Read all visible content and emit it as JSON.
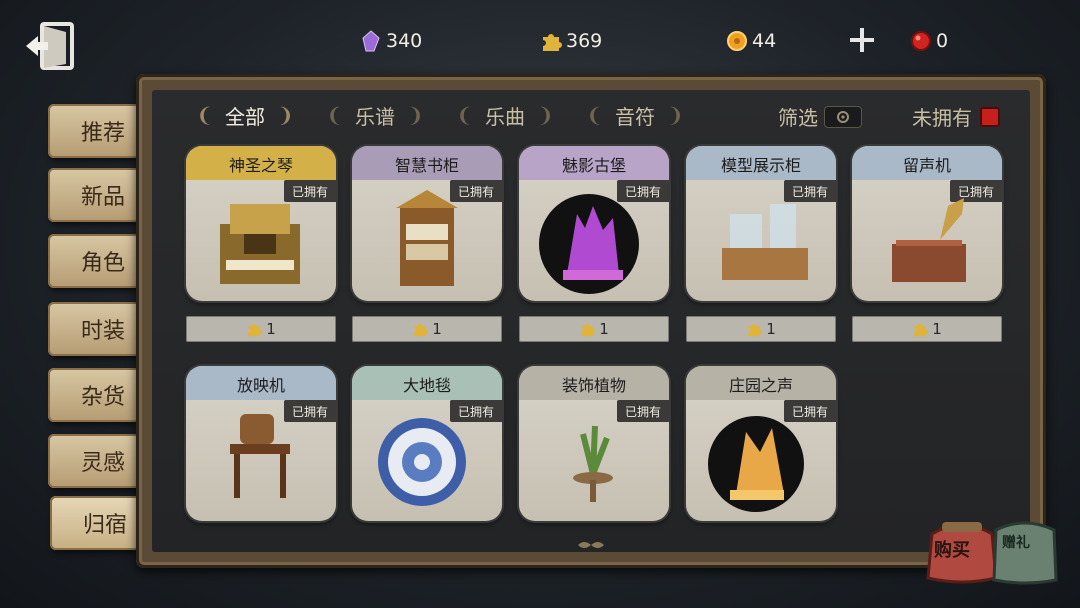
{
  "currencies": [
    {
      "name": "purple-crystal",
      "value": "340",
      "color": "#9b6bd8"
    },
    {
      "name": "puzzle",
      "value": "369",
      "color": "#e0b43a"
    },
    {
      "name": "clue",
      "value": "44",
      "color": "#f0a020"
    },
    {
      "name": "red-gem",
      "value": "0",
      "color": "#d0241f"
    }
  ],
  "side_tabs": [
    "推荐",
    "新品",
    "角色",
    "时装",
    "杂货",
    "灵感",
    "归宿"
  ],
  "active_side_tab": "归宿",
  "filter_tabs": [
    {
      "label": "全部",
      "active": true
    },
    {
      "label": "乐谱",
      "active": false
    },
    {
      "label": "乐曲",
      "active": false
    },
    {
      "label": "音符",
      "active": false
    }
  ],
  "filter_label": "筛选",
  "unowned_label": "未拥有",
  "owned_tag": "已拥有",
  "items": [
    {
      "name": "神圣之琴",
      "price": "1",
      "head_color": "#d4b148",
      "art": "organ"
    },
    {
      "name": "智慧书柜",
      "price": "1",
      "head_color": "#a99cb6",
      "art": "bookcase"
    },
    {
      "name": "魅影古堡",
      "price": "1",
      "head_color": "#b7a4c6",
      "art": "castle"
    },
    {
      "name": "模型展示柜",
      "price": "1",
      "head_color": "#aab9c8",
      "art": "cabinet"
    },
    {
      "name": "留声机",
      "price": "1",
      "head_color": "#aab9c8",
      "art": "gramophone"
    },
    {
      "name": "放映机",
      "price": "",
      "head_color": "#aab9c8",
      "art": "projector"
    },
    {
      "name": "大地毯",
      "price": "",
      "head_color": "#a8c0b6",
      "art": "carpet"
    },
    {
      "name": "装饰植物",
      "price": "",
      "head_color": "#b7b2a6",
      "art": "plant"
    },
    {
      "name": "庄园之声",
      "price": "",
      "head_color": "#b7b2a6",
      "art": "manor"
    }
  ],
  "buy_label": "购买",
  "gift_label": "赠礼",
  "colors": {
    "panel_frame": "#5a4a36",
    "tab_bg": "#c9b28c",
    "owned_bg": "#3b3a38"
  }
}
